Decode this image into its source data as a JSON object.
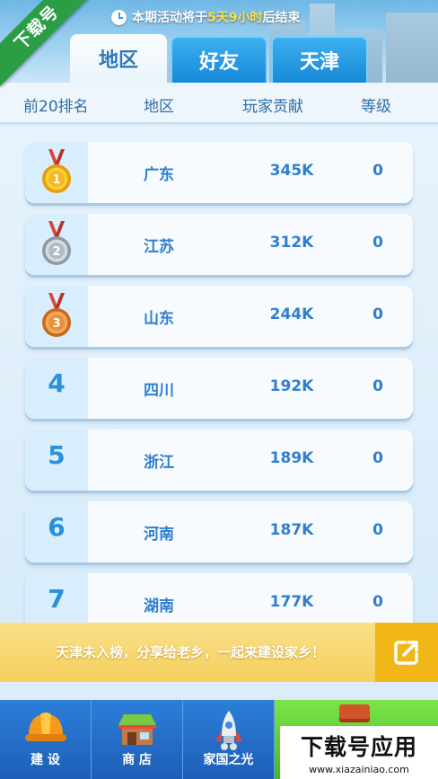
{
  "watermark": {
    "ribbon": "下载号",
    "brand": "下载号应用",
    "url": "www.xiazainiao.com"
  },
  "notice": {
    "prefix": "本期活动将于",
    "highlight": "5天9小时",
    "suffix": "后结束"
  },
  "tabs": [
    {
      "label": "地区",
      "active": true
    },
    {
      "label": "好友",
      "active": false
    },
    {
      "label": "天津",
      "active": false
    }
  ],
  "columns": {
    "rank": "前20排名",
    "region": "地区",
    "contribution": "玩家贡献",
    "level": "等级"
  },
  "rows": [
    {
      "rank": "1",
      "medal": "gold-medal-icon",
      "region": "广东",
      "contribution": "345K",
      "level": "0"
    },
    {
      "rank": "2",
      "medal": "silver-medal-icon",
      "region": "江苏",
      "contribution": "312K",
      "level": "0"
    },
    {
      "rank": "3",
      "medal": "bronze-medal-icon",
      "region": "山东",
      "contribution": "244K",
      "level": "0"
    },
    {
      "rank": "4",
      "region": "四川",
      "contribution": "192K",
      "level": "0"
    },
    {
      "rank": "5",
      "region": "浙江",
      "contribution": "189K",
      "level": "0"
    },
    {
      "rank": "6",
      "region": "河南",
      "contribution": "187K",
      "level": "0"
    },
    {
      "rank": "7",
      "region": "湖南",
      "contribution": "177K",
      "level": "0"
    }
  ],
  "share": {
    "text": "天津未入榜，分享给老乡，一起来建设家乡！",
    "icon": "share-icon"
  },
  "nav": [
    {
      "label": "建 设",
      "icon": "hard-hat-icon"
    },
    {
      "label": "商 店",
      "icon": "shop-icon"
    },
    {
      "label": "家国之光",
      "icon": "rocket-icon"
    }
  ],
  "colors": {
    "accent": "#2c8fdb",
    "tab_blue": "#1688d8",
    "banner": "#f4cf5d",
    "gold": "#f2b51c",
    "silver": "#b7bfc8",
    "bronze": "#e6913d"
  }
}
